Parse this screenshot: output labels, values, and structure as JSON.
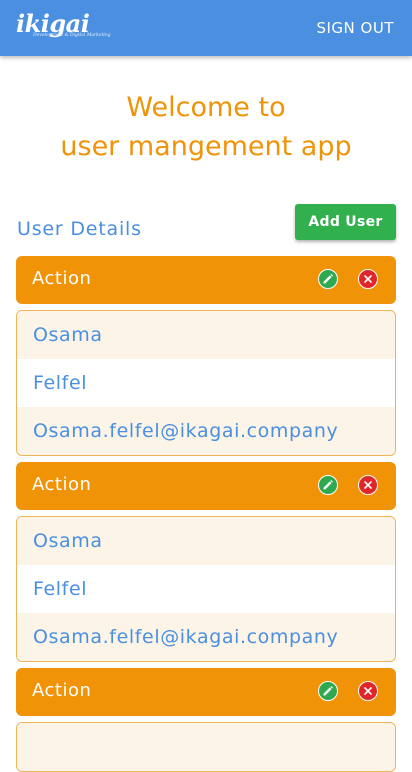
{
  "header": {
    "logo_text": "ikigai",
    "logo_tagline": "Development & Digital Marketing",
    "sign_out_label": "SIGN OUT"
  },
  "welcome": {
    "line1": "Welcome to",
    "line2": "user mangement app"
  },
  "section": {
    "title": "User Details",
    "add_button_label": "Add User"
  },
  "users": [
    {
      "action_label": "Action",
      "first_name": "Osama",
      "last_name": "Felfel",
      "email": "Osama.felfel@ikagai.company"
    },
    {
      "action_label": "Action",
      "first_name": "Osama",
      "last_name": "Felfel",
      "email": "Osama.felfel@ikagai.company"
    },
    {
      "action_label": "Action"
    }
  ],
  "colors": {
    "primary": "#4a8fe0",
    "accent": "#f09306",
    "success": "#30b14d",
    "danger": "#e0262a"
  },
  "icons": {
    "edit": "pencil-icon",
    "delete": "close-icon"
  }
}
